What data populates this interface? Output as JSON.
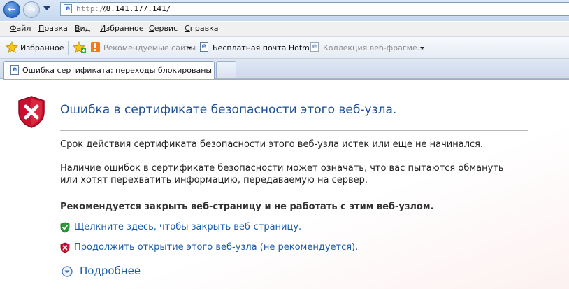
{
  "address": {
    "scheme": "http://",
    "host": "78.141.177.141/"
  },
  "menu": [
    {
      "first": "Ф",
      "rest": "айл"
    },
    {
      "first": "П",
      "rest": "равка"
    },
    {
      "first": "В",
      "rest": "ид"
    },
    {
      "first": "И",
      "rest": "збранное"
    },
    {
      "first": "С",
      "rest": "ервис"
    },
    {
      "first": "С",
      "rest": "правка"
    }
  ],
  "favorites": {
    "button_label": "Избранное",
    "items": [
      {
        "label": "Рекомендуемые сайты",
        "has_dropdown": true,
        "enabled": false
      },
      {
        "label": "Бесплатная почта Hotmail",
        "has_dropdown": false,
        "enabled": true
      },
      {
        "label": "Коллекция веб-фрагме...",
        "has_dropdown": true,
        "enabled": false
      }
    ]
  },
  "tab": {
    "title": "Ошибка сертификата: переходы блокированы"
  },
  "page": {
    "title": "Ошибка в сертификате безопасности этого веб-узла.",
    "paragraph1": "Срок действия сертификата безопасности этого веб-узла истек или еще не начинался.",
    "paragraph2_line1": "Наличие ошибок в сертификате безопасности может означать, что вас пытаются обмануть",
    "paragraph2_line2": "или хотят перехватить информацию, передаваемую на сервер.",
    "recommendation": "Рекомендуется закрыть веб-страницу и не работать с этим веб-узлом.",
    "close_link": "Щелкните здесь, чтобы закрыть веб-страницу.",
    "continue_link": "Продолжить открытие этого веб-узла (не рекомендуется).",
    "more_info": "Подробнее"
  },
  "colors": {
    "title_blue": "#1e4f91",
    "link_blue": "#1c5aa6",
    "shield_red": "#c8102e",
    "shield_green": "#2f9a3a"
  },
  "icons": {
    "error": "error-shield-icon",
    "safe": "green-shield-icon",
    "unsafe": "red-shield-icon",
    "expand": "expand-circle-icon"
  }
}
